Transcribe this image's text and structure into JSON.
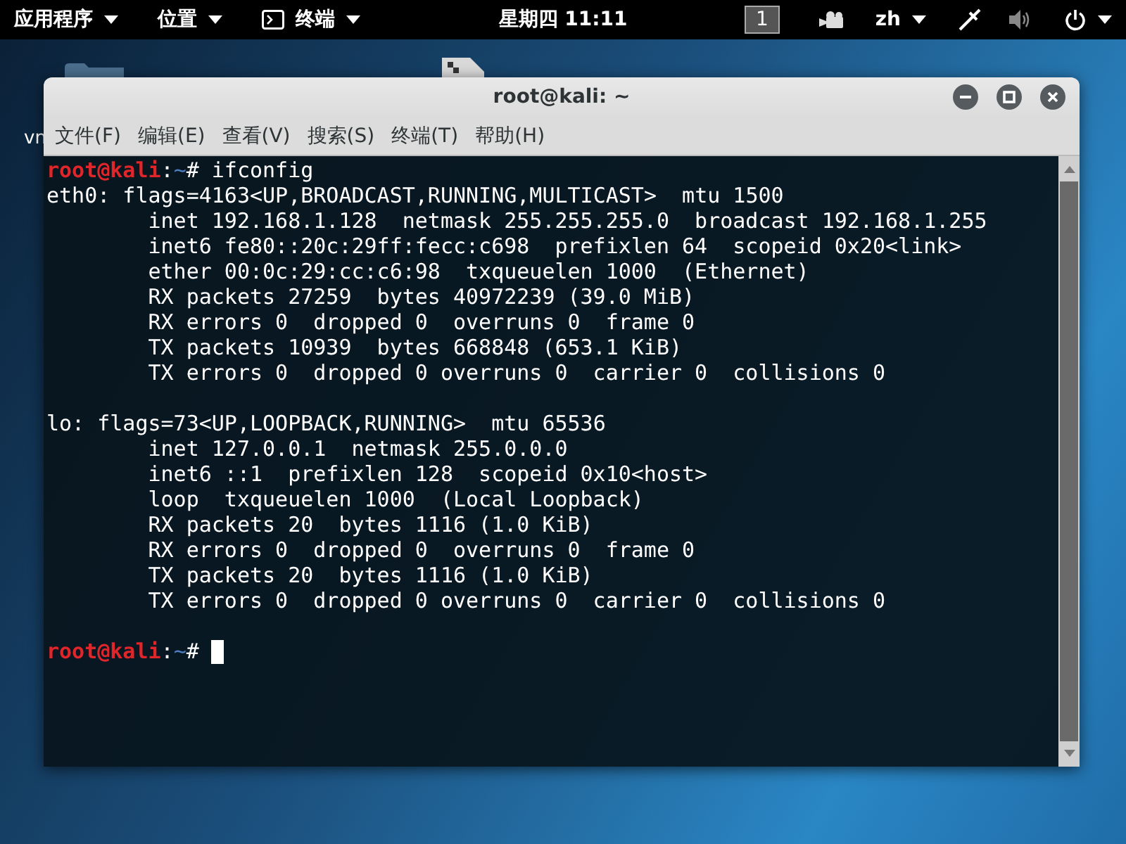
{
  "top_bar": {
    "menus": [
      {
        "label": "应用程序",
        "kind": "plain"
      },
      {
        "label": "位置",
        "kind": "plain"
      },
      {
        "label": "终端",
        "kind": "terminal"
      }
    ],
    "clock": "星期四 11:11",
    "workspace": "1",
    "language": "zh"
  },
  "desktop": {
    "icon_label": "vn"
  },
  "window": {
    "title": "root@kali: ~",
    "menu": [
      "文件(F)",
      "编辑(E)",
      "查看(V)",
      "搜索(S)",
      "终端(T)",
      "帮助(H)"
    ],
    "lines": [
      {
        "kind": "prompt",
        "user_host": "root@kali",
        "separator": ":",
        "path": "~",
        "symbol": "#",
        "command": "ifconfig"
      },
      {
        "kind": "output",
        "text": "eth0: flags=4163<UP,BROADCAST,RUNNING,MULTICAST>  mtu 1500"
      },
      {
        "kind": "indented",
        "text": "inet 192.168.1.128  netmask 255.255.255.0  broadcast 192.168.1.255"
      },
      {
        "kind": "indented",
        "text": "inet6 fe80::20c:29ff:fecc:c698  prefixlen 64  scopeid 0x20<link>"
      },
      {
        "kind": "indented",
        "text": "ether 00:0c:29:cc:c6:98  txqueuelen 1000  (Ethernet)"
      },
      {
        "kind": "indented",
        "text": "RX packets 27259  bytes 40972239 (39.0 MiB)"
      },
      {
        "kind": "indented",
        "text": "RX errors 0  dropped 0  overruns 0  frame 0"
      },
      {
        "kind": "indented",
        "text": "TX packets 10939  bytes 668848 (653.1 KiB)"
      },
      {
        "kind": "indented",
        "text": "TX errors 0  dropped 0 overruns 0  carrier 0  collisions 0"
      },
      {
        "kind": "blank"
      },
      {
        "kind": "output",
        "text": "lo: flags=73<UP,LOOPBACK,RUNNING>  mtu 65536"
      },
      {
        "kind": "indented",
        "text": "inet 127.0.0.1  netmask 255.0.0.0"
      },
      {
        "kind": "indented",
        "text": "inet6 ::1  prefixlen 128  scopeid 0x10<host>"
      },
      {
        "kind": "indented",
        "text": "loop  txqueuelen 1000  (Local Loopback)"
      },
      {
        "kind": "indented",
        "text": "RX packets 20  bytes 1116 (1.0 KiB)"
      },
      {
        "kind": "indented",
        "text": "RX errors 0  dropped 0  overruns 0  frame 0"
      },
      {
        "kind": "indented",
        "text": "TX packets 20  bytes 1116 (1.0 KiB)"
      },
      {
        "kind": "indented",
        "text": "TX errors 0  dropped 0 overruns 0  carrier 0  collisions 0"
      },
      {
        "kind": "blank"
      },
      {
        "kind": "prompt",
        "user_host": "root@kali",
        "separator": ":",
        "path": "~",
        "symbol": "#",
        "cursor": true
      }
    ]
  }
}
